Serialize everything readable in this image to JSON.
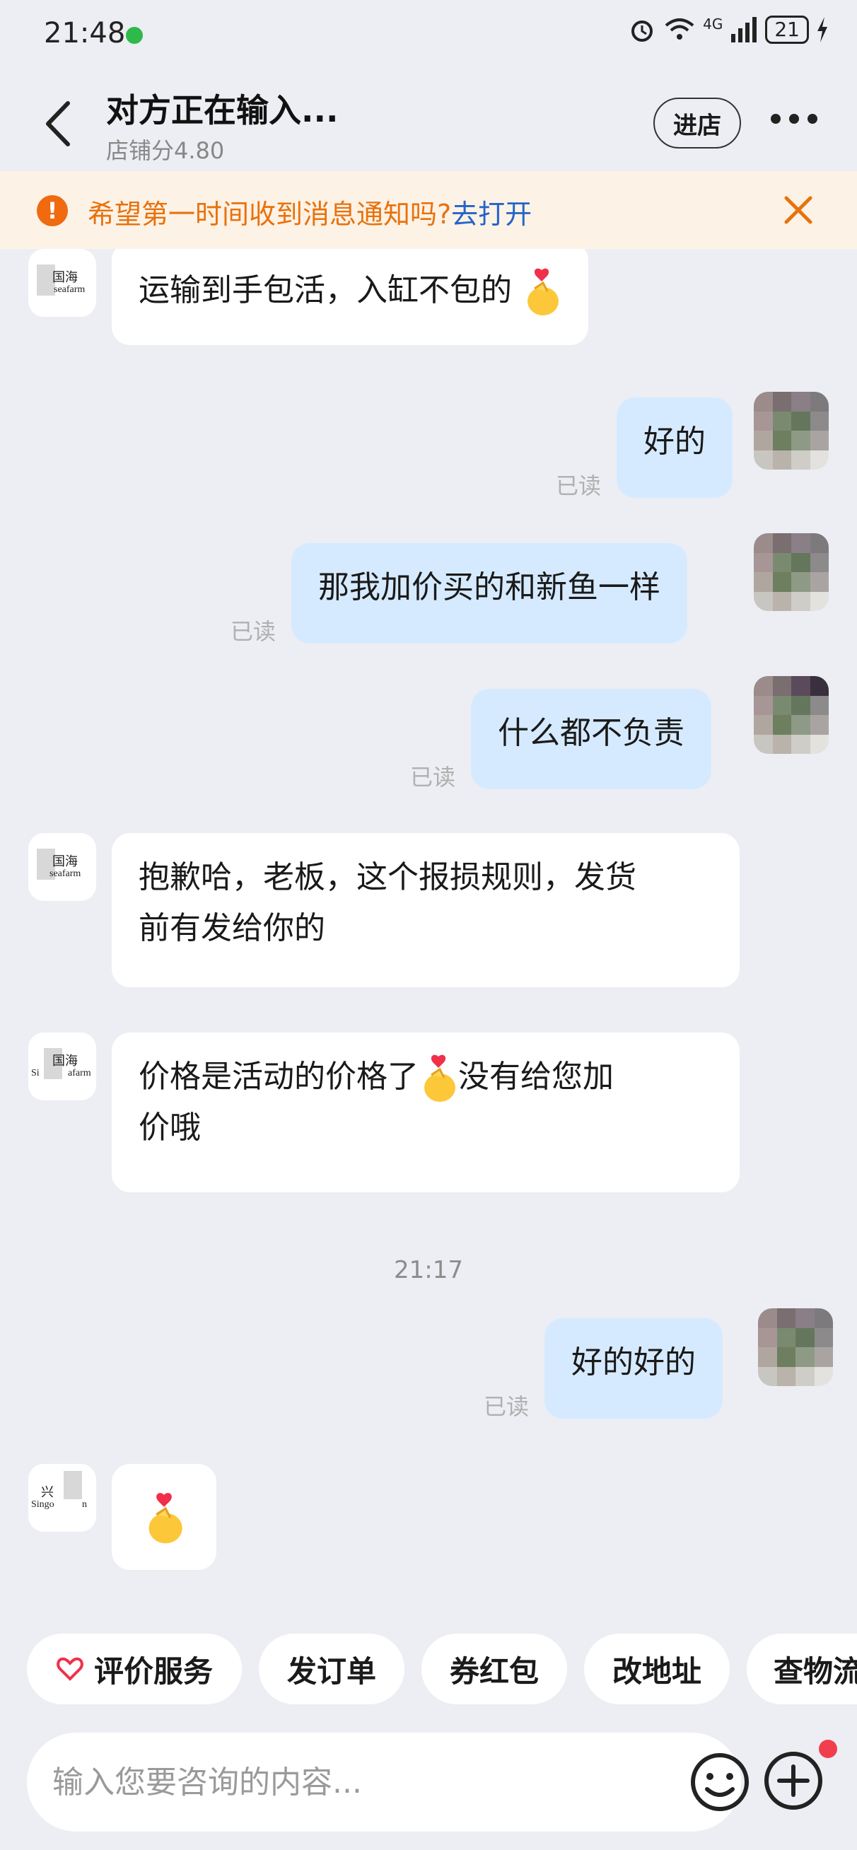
{
  "status_bar": {
    "time": "21:48",
    "network_label": "4G",
    "battery": "21"
  },
  "header": {
    "title": "对方正在输入...",
    "subtitle": "店铺分4.80",
    "store_button": "进店"
  },
  "banner": {
    "icon": "!",
    "text": "希望第一时间收到消息通知吗?",
    "link": "去打开"
  },
  "chat": {
    "messages": [
      {
        "side": "in",
        "text": "运输到手包活，入缸不包的",
        "emoji": "finger-heart"
      },
      {
        "side": "out",
        "text": "好的",
        "read": "已读"
      },
      {
        "side": "out",
        "text": "那我加价买的和新鱼一样",
        "read": "已读"
      },
      {
        "side": "out",
        "text": "什么都不负责",
        "read": "已读"
      },
      {
        "side": "in",
        "text_line1": "抱歉哈，老板，这个报损规则，发货",
        "text_line2": "前有发给你的"
      },
      {
        "side": "in",
        "text_line1a": "价格是活动的价格了",
        "text_line1b": "没有给您加",
        "text_line2": "价哦"
      },
      {
        "side": "out",
        "text": "好的好的",
        "read": "已读"
      },
      {
        "side": "in",
        "emoji": "finger-heart"
      }
    ],
    "timestamp": "21:17",
    "shop_logo": {
      "top_text": "国海",
      "bottom_text": "seafarm",
      "alt_top": "兴",
      "alt_bottom": "Singo",
      "alt_bottom_b": "n",
      "alt_mid": "Si",
      "alt_mid_b": "afarm"
    }
  },
  "quick_actions": [
    "评价服务",
    "发订单",
    "券红包",
    "改地址",
    "查物流"
  ],
  "input": {
    "placeholder": "输入您要咨询的内容..."
  },
  "colors": {
    "accent_orange": "#e8720c",
    "link_blue": "#2364c8",
    "outgoing_bubble": "#d6eaff",
    "background": "#eceef3"
  }
}
